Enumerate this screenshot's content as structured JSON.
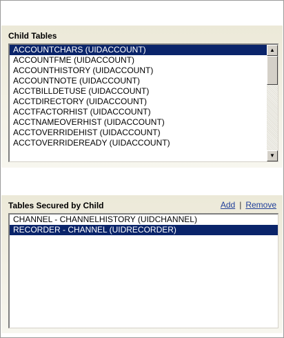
{
  "child_tables": {
    "title": "Child Tables",
    "items": [
      "ACCOUNTCHARS (UIDACCOUNT)",
      "ACCOUNTFME (UIDACCOUNT)",
      "ACCOUNTHISTORY (UIDACCOUNT)",
      "ACCOUNTNOTE (UIDACCOUNT)",
      "ACCTBILLDETUSE (UIDACCOUNT)",
      "ACCTDIRECTORY (UIDACCOUNT)",
      "ACCTFACTORHIST (UIDACCOUNT)",
      "ACCTNAMEOVERHIST (UIDACCOUNT)",
      "ACCTOVERRIDEHIST (UIDACCOUNT)",
      "ACCTOVERRIDEREADY (UIDACCOUNT)"
    ],
    "selected_index": 0,
    "scroll": {
      "up_glyph": "▲",
      "down_glyph": "▼"
    }
  },
  "secured_tables": {
    "title": "Tables Secured by Child",
    "add_label": "Add",
    "separator": "|",
    "remove_label": "Remove",
    "items": [
      "CHANNEL - CHANNELHISTORY (UIDCHANNEL)",
      "RECORDER - CHANNEL (UIDRECORDER)"
    ],
    "selected_index": 1
  },
  "colors": {
    "selection_bg": "#0a246a",
    "link": "#1f3f9a",
    "panel_bg": "#ece9d8"
  }
}
